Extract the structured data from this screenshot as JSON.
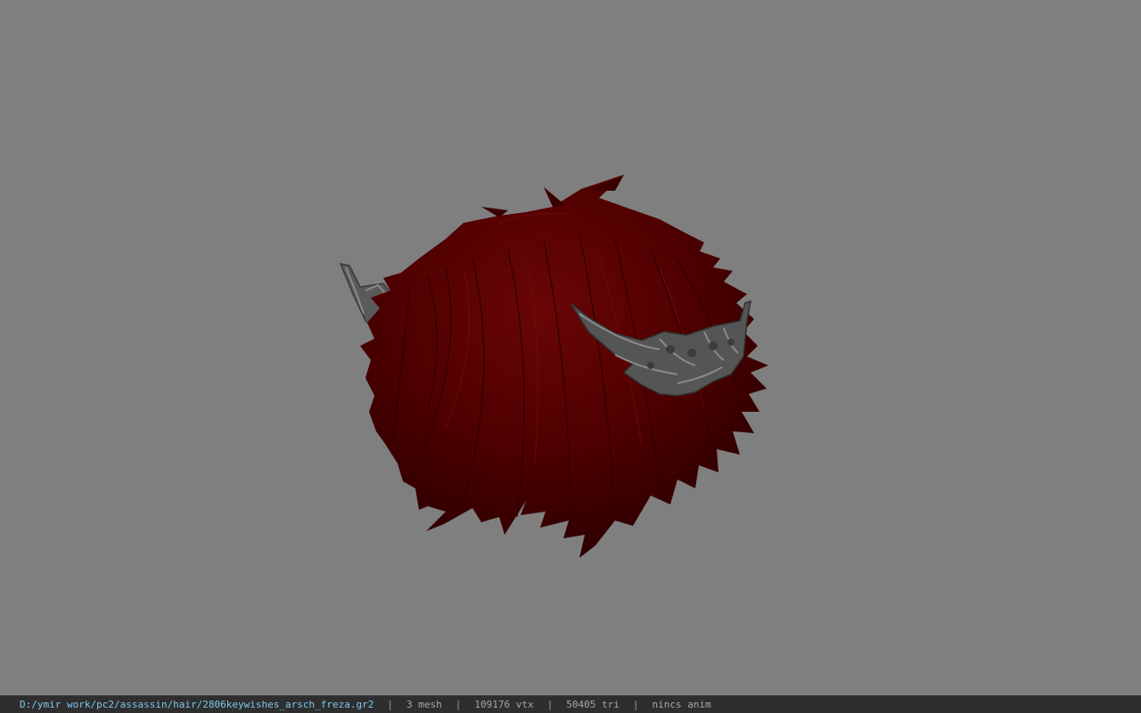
{
  "viewport": {
    "background_color": "#7f7f7f",
    "model": {
      "hair_color": "#4f0000",
      "hair_highlight": "#6a0606",
      "hair_shadow": "#2e0000",
      "ornament_color": "#5a5a5a",
      "ornament_highlight": "#8a8a8a"
    }
  },
  "statusbar": {
    "file_path": "D:/ymir work/pc2/assassin/hair/2806keywishes_arsch_freza.gr2",
    "separator": "|",
    "mesh_count": "3 mesh",
    "vertex_count": "109176 vtx",
    "triangle_count": "50405 tri",
    "anim_status": "nincs anim",
    "path_color": "#7fc6ee",
    "text_color": "#a6a6a6",
    "background_color": "#2e2e2e"
  }
}
